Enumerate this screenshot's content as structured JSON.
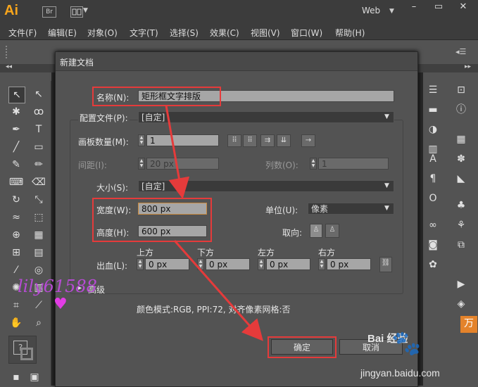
{
  "app": {
    "logo": "Ai",
    "bridge_label": "Br",
    "workspace": "Web"
  },
  "menubar": [
    "文件(F)",
    "编辑(E)",
    "对象(O)",
    "文字(T)",
    "选择(S)",
    "效果(C)",
    "视图(V)",
    "窗口(W)",
    "帮助(H)"
  ],
  "dialog": {
    "title": "新建文档",
    "name_label": "名称(N):",
    "name_value": "矩形框文字排版",
    "profile_label": "配置文件(P):",
    "profile_value": "[自定]",
    "artboards_label": "画板数量(M):",
    "artboards_value": "1",
    "spacing_label": "间距(I):",
    "spacing_value": "20 px",
    "columns_label": "列数(O):",
    "columns_value": "1",
    "size_label": "大小(S):",
    "size_value": "[自定]",
    "width_label": "宽度(W):",
    "width_value": "800 px",
    "units_label": "单位(U):",
    "units_value": "像素",
    "height_label": "高度(H):",
    "height_value": "600 px",
    "orientation_label": "取向:",
    "bleed_label": "出血(L):",
    "bleed_top_label": "上方",
    "bleed_bottom_label": "下方",
    "bleed_left_label": "左方",
    "bleed_right_label": "右方",
    "bleed_top": "0 px",
    "bleed_bottom": "0 px",
    "bleed_left": "0 px",
    "bleed_right": "0 px",
    "advanced_label": "高级",
    "info_text": "颜色模式:RGB, PPI:72, 对齐像素网格:否",
    "ok_label": "确定",
    "cancel_label": "取消"
  },
  "watermark": {
    "text": "lily61588",
    "site_name": "Bai 经验",
    "site_url": "jingyan.baidu.com"
  },
  "annotation_color": "#e53b3b"
}
